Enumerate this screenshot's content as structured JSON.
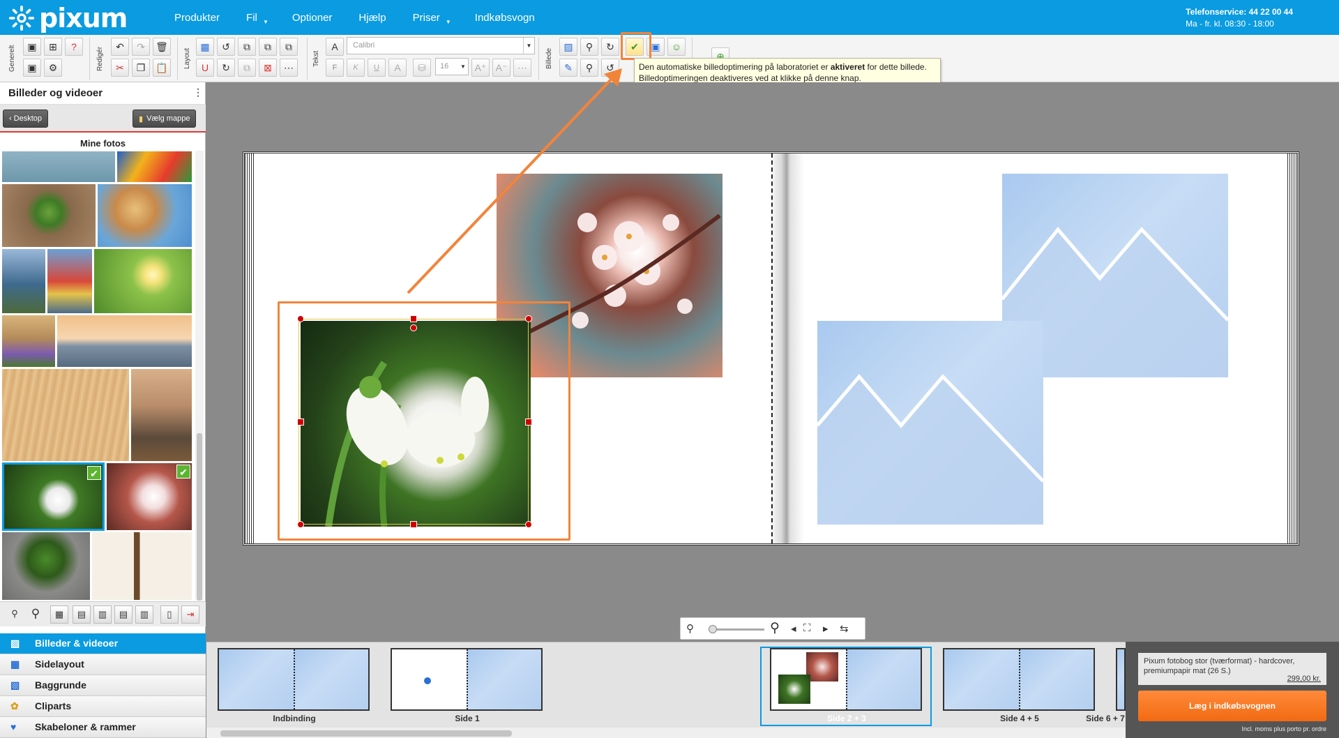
{
  "brand": {
    "name": "pixum",
    "color": "#0a9be0",
    "accent": "#f2843a"
  },
  "nav": [
    {
      "label": "Produkter"
    },
    {
      "label": "Fil"
    },
    {
      "label": "Optioner"
    },
    {
      "label": "Hjælp"
    },
    {
      "label": "Priser"
    },
    {
      "label": "Indkøbsvogn"
    }
  ],
  "contact": {
    "phone": "Telefonservice: 44 22 00 44",
    "hours": "Ma - fr. kl. 08:30 - 18:00"
  },
  "ribbon": {
    "groups": {
      "general": "Generelt",
      "edit": "Redigér",
      "layout": "Layout",
      "text": "Tekst",
      "image": "Billede"
    },
    "font": {
      "name": "Calibri",
      "size": "16"
    },
    "format": {
      "bold": "F",
      "italic": "K",
      "underline": "U"
    }
  },
  "tooltip": {
    "pre": "Den automatiske billedoptimering på laboratoriet er ",
    "bold": "aktiveret",
    "post": " for dette billede.",
    "line2": "Billedoptimeringen deaktiveres ved at klikke på denne knap."
  },
  "sidebar": {
    "title": "Billeder og videoer",
    "desktop_button": "Desktop",
    "choose_folder_button": "Vælg mappe",
    "photos_heading": "Mine fotos",
    "menu": [
      {
        "label": "Billeder & videoer",
        "icon": "image-icon"
      },
      {
        "label": "Sidelayout",
        "icon": "layout-icon"
      },
      {
        "label": "Baggrunde",
        "icon": "background-icon"
      },
      {
        "label": "Cliparts",
        "icon": "clipart-icon"
      },
      {
        "label": "Skabeloner & rammer",
        "icon": "template-icon"
      }
    ]
  },
  "filmstrip": {
    "pages": [
      {
        "label": "Indbinding"
      },
      {
        "label": "Side 1"
      },
      {
        "label": "Side 2 + 3"
      },
      {
        "label": "Side 4 + 5"
      },
      {
        "label": "Side 6 + 7"
      }
    ],
    "selected": "Side 2 + 3"
  },
  "order": {
    "product": "Pixum fotobog stor (tværformat) - hardcover, premiumpapir mat  (26 S.)",
    "price": "299,00 kr.",
    "cart_button": "Læg i indkøbsvognen",
    "vat_note": "Incl. moms plus porto pr. ordre"
  }
}
